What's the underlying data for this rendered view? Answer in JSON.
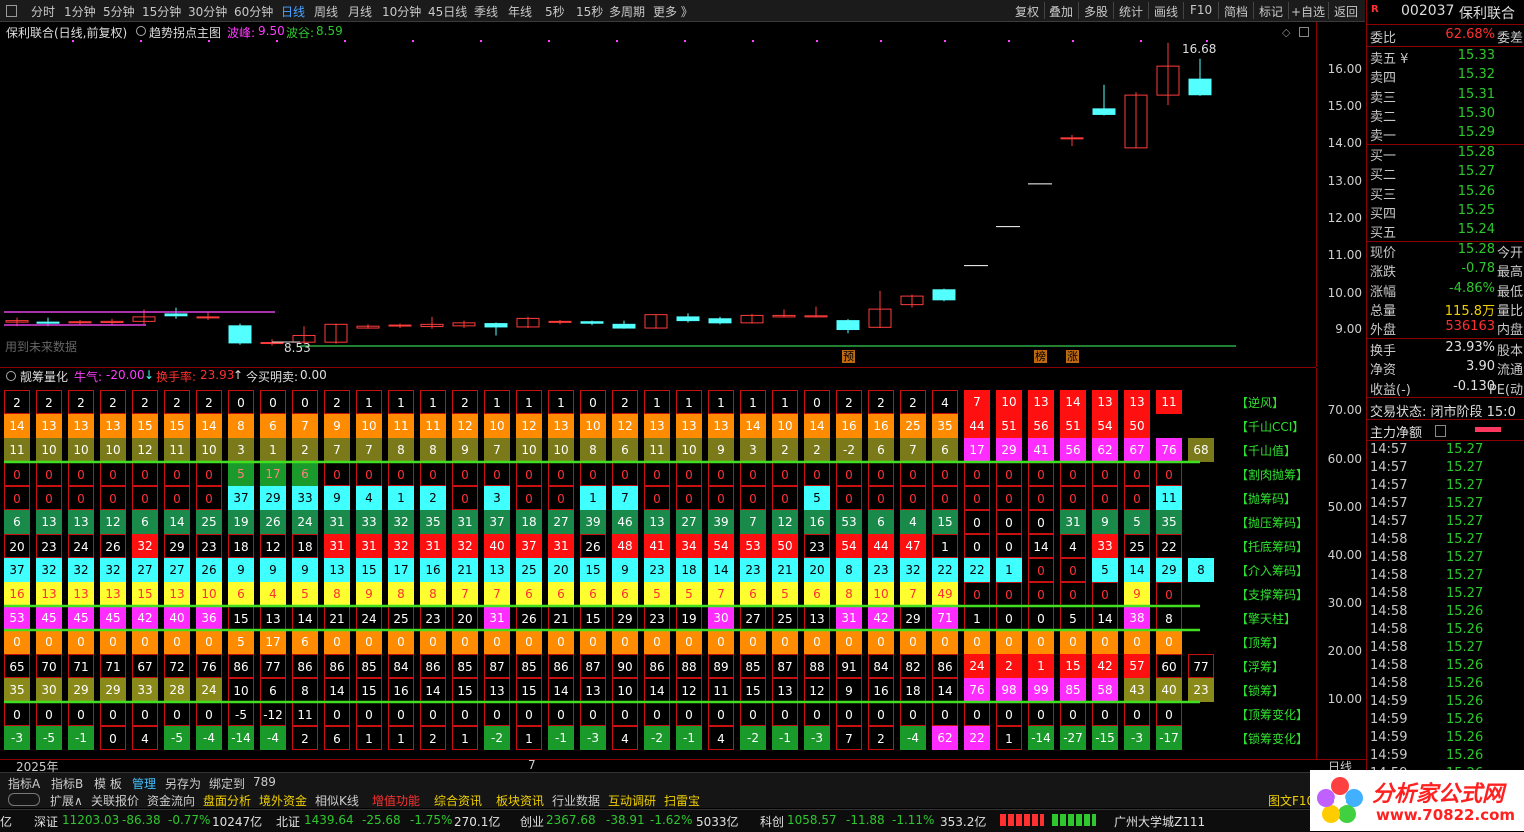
{
  "toolbar": {
    "tabs": [
      "分时",
      "1分钟",
      "5分钟",
      "15分钟",
      "30分钟",
      "60分钟",
      "日线",
      "周线",
      "月线",
      "10分钟",
      "45日线",
      "季线",
      "年线",
      "5秒",
      "15秒",
      "多周期",
      "更多 》"
    ],
    "right_buttons": [
      "复权",
      "叠加",
      "多股",
      "统计",
      "画线",
      "F10",
      "简档",
      "标记",
      "+自选",
      "返回"
    ]
  },
  "main_chart": {
    "title": "保利联合(日线,前复权)",
    "indicator": "趋势拐点主图",
    "peak_label": "波峰:",
    "peak_value": "9.50",
    "trough_label": "波谷:",
    "trough_value": "8.59",
    "future_note": "用到未来数据",
    "high_mark": "16.68",
    "low_mark": "8.53",
    "signals": [
      "预",
      "榜",
      "涨"
    ],
    "y_ticks": [
      "16.00",
      "15.00",
      "14.00",
      "13.00",
      "12.00",
      "11.00",
      "10.00",
      "9.00"
    ]
  },
  "indicator_panel": {
    "name": "靓筹量化",
    "bull_label": "牛气:",
    "bull_value": "-20.00",
    "turnover_label": "换手率:",
    "turnover_value": "23.93",
    "buy_sell_label": "今买明卖:",
    "buy_sell_value": "0.00",
    "y_ticks": [
      "70.00",
      "60.00",
      "50.00",
      "40.00",
      "30.00",
      "20.00",
      "10.00"
    ],
    "row_labels": [
      "【逆风】",
      "【千山CCI】",
      "【千山值】",
      "【割肉抛筹】",
      "【抛筹码】",
      "【抛压筹码】",
      "【托底筹码】",
      "【介入筹码】",
      "【支撑筹码】",
      "【擎天柱】",
      "【顶筹】",
      "【浮筹】",
      "【锁筹】",
      "【顶筹变化】",
      "【锁筹变化】"
    ],
    "rows": [
      [
        "2",
        "2",
        "2",
        "2",
        "2",
        "2",
        "2",
        "0",
        "0",
        "0",
        "2",
        "1",
        "1",
        "1",
        "2",
        "1",
        "1",
        "1",
        "0",
        "2",
        "1",
        "1",
        "1",
        "1",
        "1",
        "0",
        "2",
        "2",
        "2",
        "4",
        "7",
        "10",
        "13",
        "14",
        "13",
        "13",
        "11"
      ],
      [
        "14",
        "13",
        "13",
        "13",
        "15",
        "15",
        "14",
        "8",
        "6",
        "7",
        "9",
        "10",
        "11",
        "11",
        "12",
        "10",
        "12",
        "13",
        "10",
        "12",
        "13",
        "13",
        "13",
        "14",
        "10",
        "14",
        "16",
        "16",
        "25",
        "35",
        "44",
        "51",
        "56",
        "51",
        "54",
        "50"
      ],
      [
        "11",
        "10",
        "10",
        "10",
        "12",
        "11",
        "10",
        "3",
        "1",
        "2",
        "7",
        "7",
        "8",
        "8",
        "9",
        "7",
        "10",
        "10",
        "8",
        "6",
        "11",
        "10",
        "9",
        "3",
        "2",
        "2",
        "-2",
        "6",
        "7",
        "6",
        "17",
        "29",
        "41",
        "56",
        "62",
        "67",
        "76",
        "68"
      ],
      [
        "0",
        "0",
        "0",
        "0",
        "0",
        "0",
        "0",
        "5",
        "17",
        "6",
        "0",
        "0",
        "0",
        "0",
        "0",
        "0",
        "0",
        "0",
        "0",
        "0",
        "0",
        "0",
        "0",
        "0",
        "0",
        "0",
        "0",
        "0",
        "0",
        "0",
        "0",
        "0",
        "0",
        "0",
        "0",
        "0",
        "0"
      ],
      [
        "0",
        "0",
        "0",
        "0",
        "0",
        "0",
        "0",
        "37",
        "29",
        "33",
        "9",
        "4",
        "1",
        "2",
        "0",
        "3",
        "0",
        "0",
        "1",
        "7",
        "0",
        "0",
        "0",
        "0",
        "0",
        "5",
        "0",
        "0",
        "0",
        "0",
        "0",
        "0",
        "0",
        "0",
        "0",
        "0",
        "11"
      ],
      [
        "6",
        "13",
        "13",
        "12",
        "6",
        "14",
        "25",
        "19",
        "26",
        "24",
        "31",
        "33",
        "32",
        "35",
        "31",
        "37",
        "18",
        "27",
        "39",
        "46",
        "13",
        "27",
        "39",
        "7",
        "12",
        "16",
        "53",
        "6",
        "4",
        "15",
        "0",
        "0",
        "0",
        "31",
        "9",
        "5",
        "35"
      ],
      [
        "20",
        "23",
        "24",
        "26",
        "32",
        "29",
        "23",
        "18",
        "12",
        "18",
        "31",
        "31",
        "32",
        "31",
        "32",
        "40",
        "37",
        "31",
        "26",
        "48",
        "41",
        "34",
        "54",
        "53",
        "50",
        "23",
        "54",
        "44",
        "47",
        "1",
        "0",
        "0",
        "14",
        "4",
        "33",
        "25",
        "22"
      ],
      [
        "37",
        "32",
        "32",
        "32",
        "27",
        "27",
        "26",
        "9",
        "9",
        "9",
        "13",
        "15",
        "17",
        "16",
        "21",
        "13",
        "25",
        "20",
        "15",
        "9",
        "23",
        "18",
        "14",
        "23",
        "21",
        "20",
        "8",
        "23",
        "32",
        "22",
        "22",
        "1",
        "0",
        "0",
        "5",
        "14",
        "29",
        "8"
      ],
      [
        "16",
        "13",
        "13",
        "13",
        "15",
        "13",
        "10",
        "6",
        "4",
        "5",
        "8",
        "9",
        "8",
        "8",
        "7",
        "7",
        "6",
        "6",
        "6",
        "6",
        "5",
        "5",
        "7",
        "6",
        "5",
        "6",
        "8",
        "10",
        "7",
        "49",
        "0",
        "0",
        "0",
        "0",
        "0",
        "9",
        "0"
      ],
      [
        "53",
        "45",
        "45",
        "45",
        "42",
        "40",
        "36",
        "15",
        "13",
        "14",
        "21",
        "24",
        "25",
        "23",
        "20",
        "31",
        "26",
        "21",
        "15",
        "29",
        "23",
        "19",
        "30",
        "27",
        "25",
        "13",
        "31",
        "42",
        "29",
        "71",
        "1",
        "0",
        "0",
        "5",
        "14",
        "38",
        "8"
      ],
      [
        "0",
        "0",
        "0",
        "0",
        "0",
        "0",
        "0",
        "5",
        "17",
        "6",
        "0",
        "0",
        "0",
        "0",
        "0",
        "0",
        "0",
        "0",
        "0",
        "0",
        "0",
        "0",
        "0",
        "0",
        "0",
        "0",
        "0",
        "0",
        "0",
        "0",
        "0",
        "0",
        "0",
        "0",
        "0",
        "0",
        "0"
      ],
      [
        "65",
        "70",
        "71",
        "71",
        "67",
        "72",
        "76",
        "86",
        "77",
        "86",
        "86",
        "85",
        "84",
        "86",
        "85",
        "87",
        "85",
        "86",
        "87",
        "90",
        "86",
        "88",
        "89",
        "85",
        "87",
        "88",
        "91",
        "84",
        "82",
        "86",
        "24",
        "2",
        "1",
        "15",
        "42",
        "57",
        "60",
        "77"
      ],
      [
        "35",
        "30",
        "29",
        "29",
        "33",
        "28",
        "24",
        "10",
        "6",
        "8",
        "14",
        "15",
        "16",
        "14",
        "15",
        "13",
        "15",
        "14",
        "13",
        "10",
        "14",
        "12",
        "11",
        "15",
        "13",
        "12",
        "9",
        "16",
        "18",
        "14",
        "76",
        "98",
        "99",
        "85",
        "58",
        "43",
        "40",
        "23"
      ],
      [
        "0",
        "0",
        "0",
        "0",
        "0",
        "0",
        "0",
        "-5",
        "-12",
        "11",
        "0",
        "0",
        "0",
        "0",
        "0",
        "0",
        "0",
        "0",
        "0",
        "0",
        "0",
        "0",
        "0",
        "0",
        "0",
        "0",
        "0",
        "0",
        "0",
        "0",
        "0",
        "0",
        "0",
        "0",
        "0",
        "0",
        "0"
      ],
      [
        "-3",
        "-5",
        "-1",
        "0",
        "4",
        "-5",
        "-4",
        "-14",
        "-4",
        "2",
        "6",
        "1",
        "1",
        "2",
        "1",
        "-2",
        "1",
        "-1",
        "-3",
        "4",
        "-2",
        "-1",
        "4",
        "-2",
        "-1",
        "-3",
        "7",
        "2",
        "-4",
        "62",
        "22",
        "1",
        "-14",
        "-27",
        "-15",
        "-3",
        "-17"
      ]
    ]
  },
  "xaxis": {
    "year": "2025年",
    "month": "7",
    "period": "日线"
  },
  "quote": {
    "code": "002037",
    "name": "保利联合",
    "wb_label": "委比",
    "wb_value": "62.68%",
    "wc_label": "委差",
    "asks": [
      [
        "卖五 ¥",
        "15.33"
      ],
      [
        "卖四",
        "15.32"
      ],
      [
        "卖三",
        "15.31"
      ],
      [
        "卖二",
        "15.30"
      ],
      [
        "卖一",
        "15.29"
      ]
    ],
    "bids": [
      [
        "买一",
        "15.28"
      ],
      [
        "买二",
        "15.27"
      ],
      [
        "买三",
        "15.26"
      ],
      [
        "买四",
        "15.25"
      ],
      [
        "买五",
        "15.24"
      ]
    ],
    "stats": [
      [
        "现价",
        "15.28",
        "今开"
      ],
      [
        "涨跌",
        "-0.78",
        "最高"
      ],
      [
        "涨幅",
        "-4.86%",
        "最低"
      ],
      [
        "总量",
        "115.8万",
        "量比"
      ],
      [
        "外盘",
        "536163",
        "内盘"
      ]
    ],
    "stats2": [
      [
        "换手",
        "23.93%",
        "股本"
      ],
      [
        "净资",
        "3.90",
        "流通"
      ],
      [
        "收益(-)",
        "-0.130",
        "PE(动"
      ]
    ],
    "trade_status": "交易状态: 闭市阶段 15:0",
    "main_net": "主力净额",
    "ticks": [
      [
        "14:57",
        "15.27"
      ],
      [
        "14:57",
        "15.27"
      ],
      [
        "14:57",
        "15.27"
      ],
      [
        "14:57",
        "15.27"
      ],
      [
        "14:57",
        "15.27"
      ],
      [
        "14:58",
        "15.27"
      ],
      [
        "14:58",
        "15.27"
      ],
      [
        "14:58",
        "15.27"
      ],
      [
        "14:58",
        "15.27"
      ],
      [
        "14:58",
        "15.26"
      ],
      [
        "14:58",
        "15.26"
      ],
      [
        "14:58",
        "15.27"
      ],
      [
        "14:58",
        "15.26"
      ],
      [
        "14:58",
        "15.26"
      ],
      [
        "14:59",
        "15.26"
      ],
      [
        "14:59",
        "15.26"
      ],
      [
        "14:59",
        "15.26"
      ],
      [
        "14:59",
        "15.26"
      ],
      [
        "14:59",
        "15.26"
      ]
    ]
  },
  "tabs_bar": [
    "指标A",
    "指标B",
    "模 板",
    "管理",
    "另存为",
    "绑定到",
    "789"
  ],
  "func_bar": [
    "扩展∧",
    "关联报价",
    "资金流向",
    "盘面分析",
    "境外资金",
    "相似K线",
    "增值功能",
    "综合资讯",
    "板块资讯",
    "行业数据",
    "互动调研",
    "扫雷宝",
    "图文F10"
  ],
  "index_bar": {
    "sz_label": "深证",
    "sz": "11203.03",
    "sz_chg": "-86.38",
    "sz_pct": "-0.77%",
    "sz_amt": "10247亿",
    "bz_label": "北证",
    "bz": "1439.64",
    "bz_chg": "-25.68",
    "bz_pct": "-1.75%",
    "bz_amt": "270.1亿",
    "cy_label": "创业",
    "cy": "2367.68",
    "cy_chg": "-38.91",
    "cy_pct": "-1.62%",
    "cy_amt": "5033亿",
    "kc_label": "科创",
    "kc": "1058.57",
    "kc_chg": "-11.88",
    "kc_pct": "-1.11%",
    "kc_amt": "353.2亿",
    "lead": "亿",
    "news": "广州大学城Z111"
  },
  "watermark": {
    "title": "分析家公式网",
    "url": "www.70822.com"
  },
  "colors": {
    "up": "#ff3030",
    "down": "#2ec72e",
    "cyan": "#40ffff",
    "magenta": "#ff3cff",
    "orange": "#ff8c00",
    "yellow": "#f0f000"
  }
}
